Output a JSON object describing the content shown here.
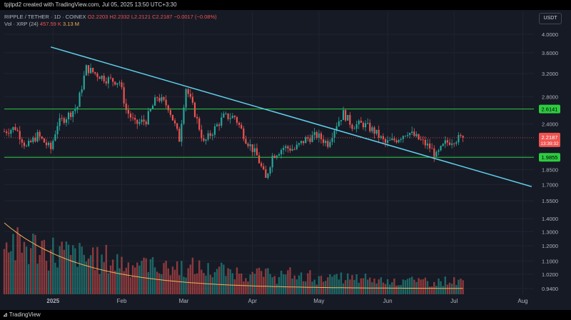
{
  "header": {
    "caption": "tpjtpd2 created with TradingView.com, Jul 05, 2025 13:50 UTC+3:30"
  },
  "legend": {
    "symbol": "RIPPLE / TETHER · 1D · COINEX",
    "open": "O2.2203",
    "high": "H2.2332",
    "low": "L2.2121",
    "close": "C2.2187",
    "change": "−0.0017 (−0.08%)",
    "volume_label": "Vol · XRP (24)",
    "volume_value": "457.59 K",
    "volume_ma": "3.13 M"
  },
  "currency_button": "USDT",
  "footer": {
    "brand": "TradingView"
  },
  "colors": {
    "background": "#161a25",
    "up": "#26a69a",
    "down": "#ef5350",
    "trendline": "#5fd0ea",
    "horizontal_level": "#2ecc40",
    "volume_ma": "#f0b35b",
    "current_price": "#ef5350"
  },
  "chart_data": {
    "type": "candlestick",
    "title": "RIPPLE / TETHER · 1D · COINEX",
    "y_scale": "log",
    "ylim": [
      0.91,
      4.2
    ],
    "y_ticks": [
      4.0,
      3.6,
      3.2,
      2.8,
      2.4,
      2.0,
      1.85,
      1.7,
      1.55,
      1.4,
      1.3,
      1.2,
      1.1,
      1.02,
      0.94
    ],
    "y_tick_labels": [
      "4.0000",
      "3.6000",
      "3.2000",
      "2.8000",
      "2.4000",
      "2.0000",
      "1.8500",
      "1.7000",
      "1.5500",
      "1.4000",
      "1.3000",
      "1.2000",
      "1.1000",
      "1.0200",
      "0.9400"
    ],
    "x_range": [
      "2024-12-10",
      "2025-08-06"
    ],
    "x_ticks": [
      {
        "date": "2025-01-01",
        "label": "2025"
      },
      {
        "date": "2025-02-01",
        "label": "Feb"
      },
      {
        "date": "2025-03-01",
        "label": "Mar"
      },
      {
        "date": "2025-04-01",
        "label": "Apr"
      },
      {
        "date": "2025-05-01",
        "label": "May"
      },
      {
        "date": "2025-06-01",
        "label": "Jun"
      },
      {
        "date": "2025-07-01",
        "label": "Jul"
      },
      {
        "date": "2025-08-01",
        "label": "Aug"
      }
    ],
    "levels": [
      {
        "price": 2.6141,
        "label": "2.6141"
      },
      {
        "price": 1.9855,
        "label": "1.9855"
      }
    ],
    "current_price": {
      "price": 2.2187,
      "label": "2.2187",
      "countdown": "13:39:32"
    },
    "trendline": [
      {
        "date": "2024-12-31",
        "price": 3.72
      },
      {
        "date": "2025-08-05",
        "price": 1.68
      }
    ],
    "closes": [
      {
        "date": "2024-12-10",
        "close": 2.3
      },
      {
        "date": "2024-12-15",
        "close": 2.35
      },
      {
        "date": "2024-12-20",
        "close": 2.1
      },
      {
        "date": "2024-12-25",
        "close": 2.25
      },
      {
        "date": "2024-12-31",
        "close": 2.08
      },
      {
        "date": "2025-01-03",
        "close": 2.4
      },
      {
        "date": "2025-01-07",
        "close": 2.5
      },
      {
        "date": "2025-01-12",
        "close": 2.65
      },
      {
        "date": "2025-01-16",
        "close": 3.3
      },
      {
        "date": "2025-01-20",
        "close": 3.2
      },
      {
        "date": "2025-01-25",
        "close": 3.1
      },
      {
        "date": "2025-01-31",
        "close": 3.05
      },
      {
        "date": "2025-02-03",
        "close": 2.6
      },
      {
        "date": "2025-02-07",
        "close": 2.4
      },
      {
        "date": "2025-02-12",
        "close": 2.45
      },
      {
        "date": "2025-02-17",
        "close": 2.8
      },
      {
        "date": "2025-02-22",
        "close": 2.65
      },
      {
        "date": "2025-02-27",
        "close": 2.2
      },
      {
        "date": "2025-03-02",
        "close": 2.95
      },
      {
        "date": "2025-03-06",
        "close": 2.55
      },
      {
        "date": "2025-03-10",
        "close": 2.15
      },
      {
        "date": "2025-03-14",
        "close": 2.3
      },
      {
        "date": "2025-03-19",
        "close": 2.5
      },
      {
        "date": "2025-03-24",
        "close": 2.5
      },
      {
        "date": "2025-03-29",
        "close": 2.2
      },
      {
        "date": "2025-04-03",
        "close": 2.0
      },
      {
        "date": "2025-04-07",
        "close": 1.75
      },
      {
        "date": "2025-04-10",
        "close": 2.0
      },
      {
        "date": "2025-04-15",
        "close": 2.1
      },
      {
        "date": "2025-04-20",
        "close": 2.08
      },
      {
        "date": "2025-04-25",
        "close": 2.2
      },
      {
        "date": "2025-04-30",
        "close": 2.25
      },
      {
        "date": "2025-05-05",
        "close": 2.15
      },
      {
        "date": "2025-05-09",
        "close": 2.4
      },
      {
        "date": "2025-05-12",
        "close": 2.55
      },
      {
        "date": "2025-05-16",
        "close": 2.38
      },
      {
        "date": "2025-05-21",
        "close": 2.4
      },
      {
        "date": "2025-05-26",
        "close": 2.3
      },
      {
        "date": "2025-05-31",
        "close": 2.15
      },
      {
        "date": "2025-06-05",
        "close": 2.2
      },
      {
        "date": "2025-06-10",
        "close": 2.3
      },
      {
        "date": "2025-06-15",
        "close": 2.2
      },
      {
        "date": "2025-06-20",
        "close": 2.1
      },
      {
        "date": "2025-06-23",
        "close": 2.0
      },
      {
        "date": "2025-06-27",
        "close": 2.15
      },
      {
        "date": "2025-07-01",
        "close": 2.2
      },
      {
        "date": "2025-07-05",
        "close": 2.2187
      }
    ],
    "volume_overlay": true
  }
}
